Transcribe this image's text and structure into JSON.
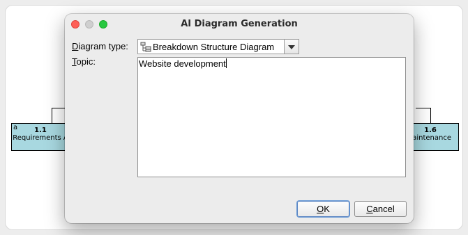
{
  "background": {
    "nodes": [
      {
        "corner_label": "a",
        "number": "1.1",
        "name": "Requirements A"
      },
      {
        "number": "1.6",
        "name": "Maintenance"
      }
    ]
  },
  "dialog": {
    "title": "AI Diagram Generation",
    "diagram_type_label_mnemonic": "D",
    "diagram_type_label_rest": "iagram type:",
    "diagram_type_value": "Breakdown Structure Diagram",
    "topic_label_mnemonic": "T",
    "topic_label_rest": "opic:",
    "topic_value": "Website development",
    "ok_mnemonic": "O",
    "ok_rest": "K",
    "cancel_mnemonic": "C",
    "cancel_rest": "ancel"
  },
  "colors": {
    "node_fill": "#a8d8e0",
    "close": "#fe5f57",
    "maximize": "#28c840"
  }
}
